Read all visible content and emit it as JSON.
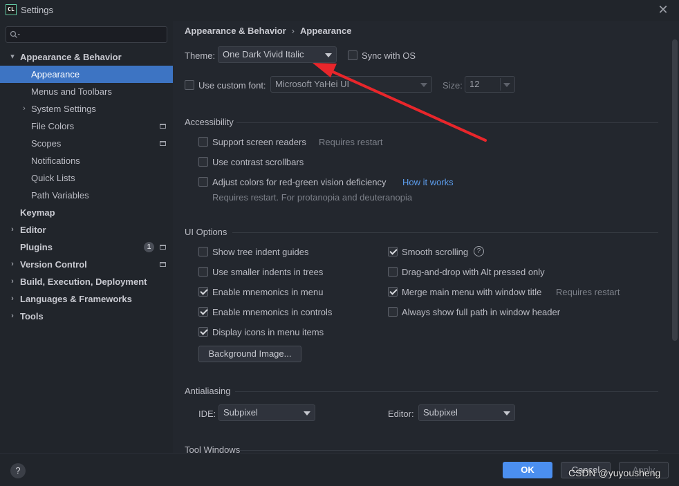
{
  "window": {
    "title": "Settings",
    "app_icon": "CL"
  },
  "sidebar": {
    "search_placeholder": "",
    "items": [
      {
        "label": "Appearance & Behavior",
        "chevron": "⌵"
      },
      {
        "label": "Appearance"
      },
      {
        "label": "Menus and Toolbars"
      },
      {
        "label": "System Settings",
        "chevron": "›"
      },
      {
        "label": "File Colors"
      },
      {
        "label": "Scopes"
      },
      {
        "label": "Notifications"
      },
      {
        "label": "Quick Lists"
      },
      {
        "label": "Path Variables"
      },
      {
        "label": "Keymap"
      },
      {
        "label": "Editor",
        "chevron": "›"
      },
      {
        "label": "Plugins",
        "badge": "1"
      },
      {
        "label": "Version Control",
        "chevron": "›"
      },
      {
        "label": "Build, Execution, Deployment",
        "chevron": "›"
      },
      {
        "label": "Languages & Frameworks",
        "chevron": "›"
      },
      {
        "label": "Tools",
        "chevron": "›"
      }
    ]
  },
  "breadcrumb": {
    "parent": "Appearance & Behavior",
    "sep": "›",
    "current": "Appearance"
  },
  "theme": {
    "label": "Theme:",
    "value": "One Dark Vivid Italic",
    "sync_label": "Sync with OS",
    "sync_checked": false
  },
  "font": {
    "custom_label": "Use custom font:",
    "custom_checked": false,
    "font_value": "Microsoft YaHei UI",
    "size_label": "Size:",
    "size_value": "12"
  },
  "accessibility": {
    "title": "Accessibility",
    "screen_readers": "Support screen readers",
    "screen_readers_note": "Requires restart",
    "contrast": "Use contrast scrollbars",
    "adjust_colors": "Adjust colors for red-green vision deficiency",
    "how_it_works": "How it works",
    "adjust_note": "Requires restart. For protanopia and deuteranopia"
  },
  "ui_options": {
    "title": "UI Options",
    "left": [
      {
        "label": "Show tree indent guides",
        "checked": false
      },
      {
        "label": "Use smaller indents in trees",
        "checked": false
      },
      {
        "label": "Enable mnemonics in menu",
        "checked": true
      },
      {
        "label": "Enable mnemonics in controls",
        "checked": true
      },
      {
        "label": "Display icons in menu items",
        "checked": true
      }
    ],
    "right": [
      {
        "label": "Smooth scrolling",
        "checked": true
      },
      {
        "label": "Drag-and-drop with Alt pressed only",
        "checked": false
      },
      {
        "label": "Merge main menu with window title",
        "checked": true
      },
      {
        "label": "Always show full path in window header",
        "checked": false
      }
    ],
    "merge_note": "Requires restart",
    "help_glyph": "?",
    "background_button": "Background Image..."
  },
  "antialiasing": {
    "title": "Antialiasing",
    "ide_label": "IDE:",
    "ide_value": "Subpixel",
    "editor_label": "Editor:",
    "editor_value": "Subpixel"
  },
  "tool_windows": {
    "title": "Tool Windows"
  },
  "footer": {
    "help": "?",
    "ok": "OK",
    "cancel": "Cancel",
    "apply": "Apply"
  },
  "watermark": "CSDN @yuyousheng",
  "colors": {
    "accent": "#3d74c3",
    "ok_button": "#4b8ff0",
    "annotation_arrow": "#e8262b",
    "link": "#5c9ded"
  }
}
